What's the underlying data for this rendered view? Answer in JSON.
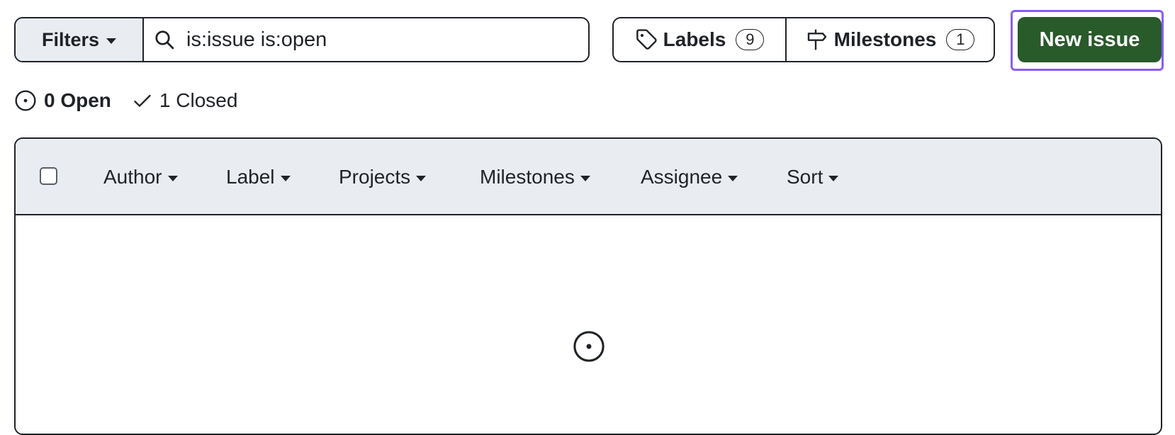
{
  "search": {
    "filters_label": "Filters",
    "query": "is:issue is:open",
    "icons": {
      "filters_caret": "caret-down-icon",
      "search": "search-icon"
    }
  },
  "nav": {
    "labels": {
      "label": "Labels",
      "count": "9",
      "icon": "tag-icon"
    },
    "milestones": {
      "label": "Milestones",
      "count": "1",
      "icon": "milestone-icon"
    }
  },
  "new_issue": {
    "label": "New issue",
    "color": "#285a2a",
    "focus_ring_color": "#8a5cf6"
  },
  "states": {
    "open": {
      "label": "0 Open",
      "icon": "issue-opened-icon"
    },
    "closed": {
      "label": "1 Closed",
      "icon": "check-icon"
    }
  },
  "table": {
    "header_bg": "#e9ecf0",
    "select_all_checked": false,
    "menus": [
      "Author",
      "Label",
      "Projects",
      "Milestones",
      "Assignee",
      "Sort"
    ],
    "empty_state_icon": "issue-opened-icon"
  }
}
